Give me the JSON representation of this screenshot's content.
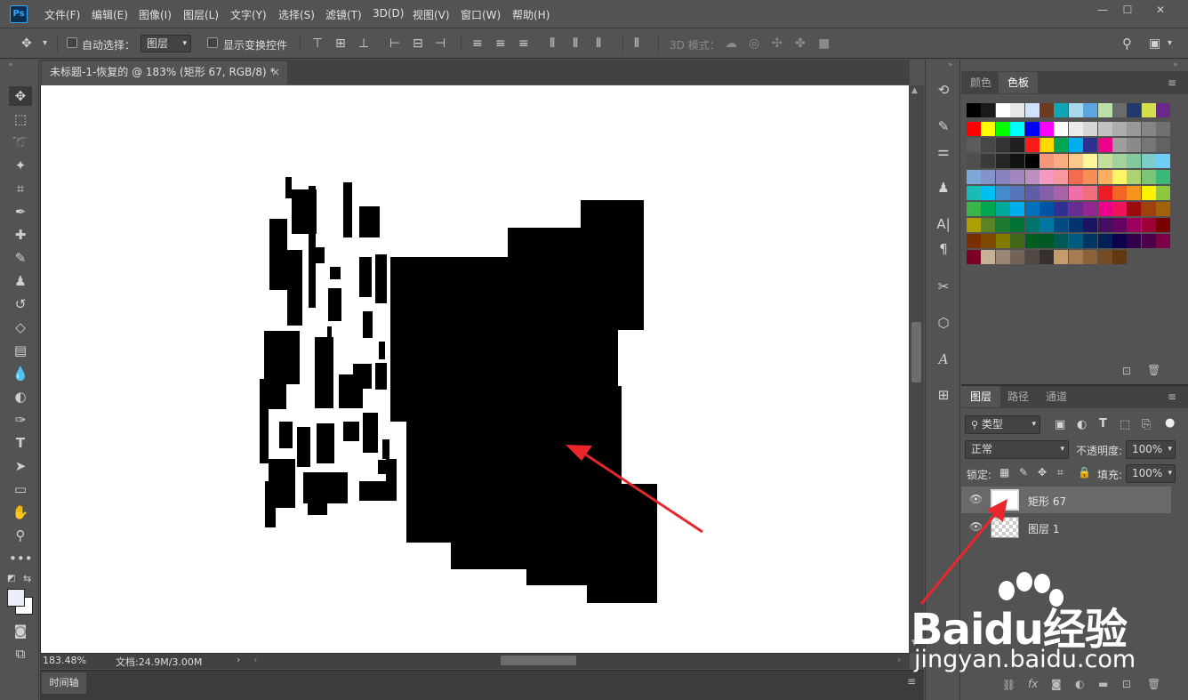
{
  "app": {
    "logo": "Ps"
  },
  "menu": [
    "文件(F)",
    "编辑(E)",
    "图像(I)",
    "图层(L)",
    "文字(Y)",
    "选择(S)",
    "滤镜(T)",
    "3D(D)",
    "视图(V)",
    "窗口(W)",
    "帮助(H)"
  ],
  "window_controls": {
    "minimize": "—",
    "maximize": "☐",
    "close": "✕"
  },
  "options": {
    "auto_select_label": "自动选择：",
    "auto_select_value": "图层",
    "show_transform_label": "显示变换控件",
    "mode_3d_label": "3D 模式："
  },
  "document": {
    "tab_title": "未标题-1-恢复的 @ 183% (矩形 67, RGB/8) *",
    "close": "×",
    "zoom": "183.48%",
    "doc_info": "文档:24.9M/3.00M"
  },
  "timeline_label": "时间轴",
  "swatches": {
    "tabs": [
      "颜色",
      "色板"
    ],
    "active_tab": "色板",
    "colors": [
      [
        "#000000",
        "#1a1a1a",
        "#ffffff",
        "#e8e8e8",
        "#cfe3ff",
        "#6b3a1f",
        "#0ea5b6",
        "#a8d8ea",
        "#5aa7e0",
        "#b8e0a8",
        "#6b6b6b",
        "#1f3a6b",
        "#d4e04a",
        "#6b2a8a"
      ],
      [
        "#ff0000",
        "#ffff00",
        "#00ff00",
        "#00ffff",
        "#0000ff",
        "#ff00ff",
        "#ffffff",
        "#ebebeb",
        "#d6d6d6",
        "#c2c2c2",
        "#adadad",
        "#999999",
        "#858585",
        "#707070"
      ],
      [
        "#5c5c5c",
        "#474747",
        "#333333",
        "#1f1f1f",
        "#ff1a1a",
        "#ffd900",
        "#00a651",
        "#00aeef",
        "#2e3192",
        "#ec008c",
        "#9e9e9e",
        "#8a8a8a",
        "#767676",
        "#626262"
      ],
      [
        "#4e4e4e",
        "#3a3a3a",
        "#262626",
        "#121212",
        "#000000",
        "#f7977a",
        "#f9ad81",
        "#fdc68a",
        "#fff79a",
        "#c4df9b",
        "#a3d39c",
        "#82ca9d",
        "#7bcdc8",
        "#6ecff6"
      ],
      [
        "#7ea7d8",
        "#8493ca",
        "#8882be",
        "#a187be",
        "#bc8dbf",
        "#f49ac2",
        "#f6989d",
        "#f26c4f",
        "#f68e55",
        "#fbaf5c",
        "#fff467",
        "#acd372",
        "#7cc576",
        "#3bb878"
      ],
      [
        "#1abbb4",
        "#00bff3",
        "#438ccb",
        "#5574b9",
        "#605ca8",
        "#855fa8",
        "#a763a8",
        "#f06eaa",
        "#f26d7d",
        "#ed1c24",
        "#f26522",
        "#f7941d",
        "#fff200",
        "#8dc63f"
      ],
      [
        "#39b54a",
        "#00a651",
        "#00a99d",
        "#00aeef",
        "#0072bc",
        "#0054a6",
        "#2e3192",
        "#662d91",
        "#92278f",
        "#ec008c",
        "#ed145b",
        "#9e0b0f",
        "#a0410d",
        "#a36209"
      ],
      [
        "#aba000",
        "#598527",
        "#1a7b30",
        "#007236",
        "#00746b",
        "#0076a3",
        "#004b80",
        "#003471",
        "#1b1464",
        "#440e62",
        "#630460",
        "#9e005d",
        "#9e0039",
        "#790000"
      ],
      [
        "#7b2e00",
        "#7d4900",
        "#827b00",
        "#406618",
        "#005e20",
        "#005826",
        "#005952",
        "#005b7f",
        "#003663",
        "#002157",
        "#0d004c",
        "#32004b",
        "#4b0049",
        "#7b0046"
      ],
      [
        "#7a0026",
        "#c7b299",
        "#998675",
        "#736357",
        "#534741",
        "#37302d",
        "#c69c6d",
        "#a67c52",
        "#8c6239",
        "#754c24",
        "#603913",
        "#000000",
        "#000000",
        "#000000"
      ]
    ]
  },
  "layers": {
    "tabs": [
      "图层",
      "路径",
      "通道"
    ],
    "active_tab": "图层",
    "filter_label": "类型",
    "blend_mode": "正常",
    "opacity_label": "不透明度:",
    "opacity_value": "100%",
    "lock_label": "锁定:",
    "fill_label": "填充:",
    "fill_value": "100%",
    "items": [
      {
        "name": "矩形 67",
        "selected": true
      },
      {
        "name": "图层 1",
        "selected": false
      }
    ]
  },
  "watermark": {
    "brand": "Baidu经验",
    "url": "jingyan.baidu.com"
  }
}
